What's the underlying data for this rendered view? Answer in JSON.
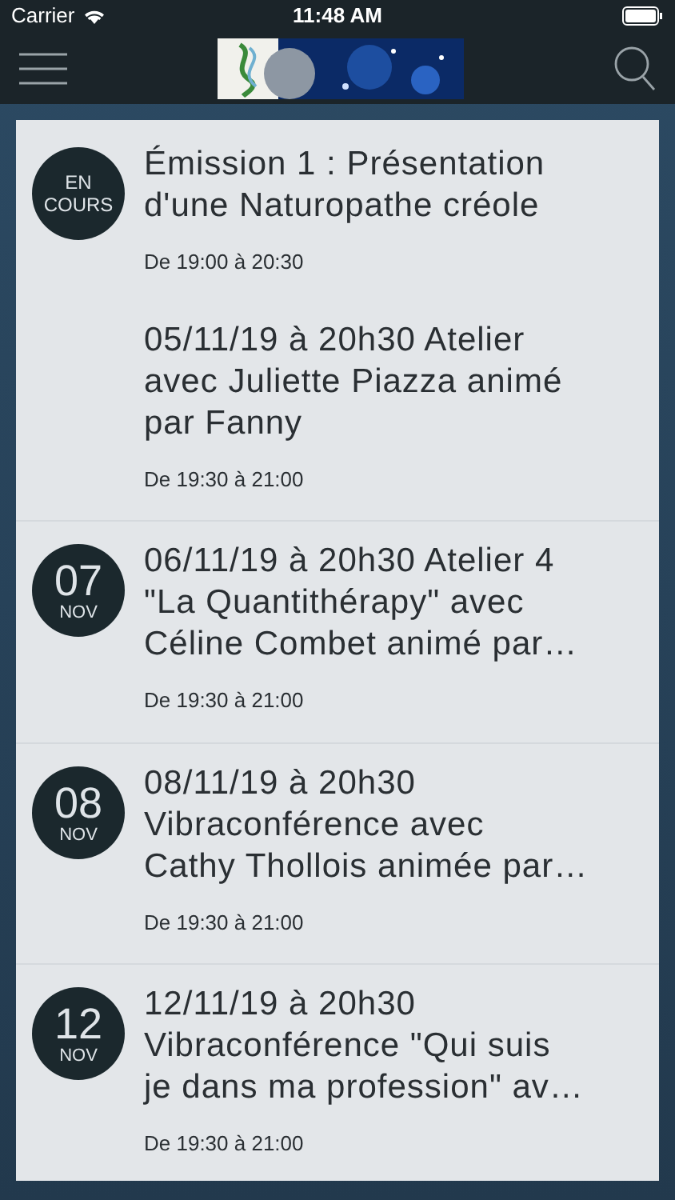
{
  "status_bar": {
    "carrier": "Carrier",
    "time": "11:48 AM"
  },
  "events": [
    {
      "badge": {
        "kind": "live",
        "line_1": "EN",
        "line_2": "COURS"
      },
      "title_lines": [
        "Émission 1 : Présentation",
        "d'une Naturopathe créole"
      ],
      "time": "De 19:00 à 20:30"
    },
    {
      "title_lines": [
        "05/11/19 à 20h30 Atelier",
        "avec Juliette Piazza animé",
        "par Fanny"
      ],
      "time": "De 19:30 à 21:00"
    },
    {
      "badge": {
        "kind": "date",
        "day": "07",
        "month": "NOV"
      },
      "title_lines": [
        "06/11/19 à 20h30 Atelier 4",
        "\"La Quantithérapy\" avec",
        "Céline Combet animé par…"
      ],
      "time": "De 19:30 à 21:00"
    },
    {
      "badge": {
        "kind": "date",
        "day": "08",
        "month": "NOV"
      },
      "title_lines": [
        "08/11/19 à 20h30",
        "Vibraconférence avec",
        "Cathy Thollois animée par…"
      ],
      "time": "De 19:30 à 21:00"
    },
    {
      "badge": {
        "kind": "date",
        "day": "12",
        "month": "NOV"
      },
      "title_lines": [
        "12/11/19 à 20h30",
        "Vibraconférence \"Qui suis",
        "je dans ma profession\" av…"
      ],
      "time": "De 19:30 à 21:00"
    }
  ]
}
